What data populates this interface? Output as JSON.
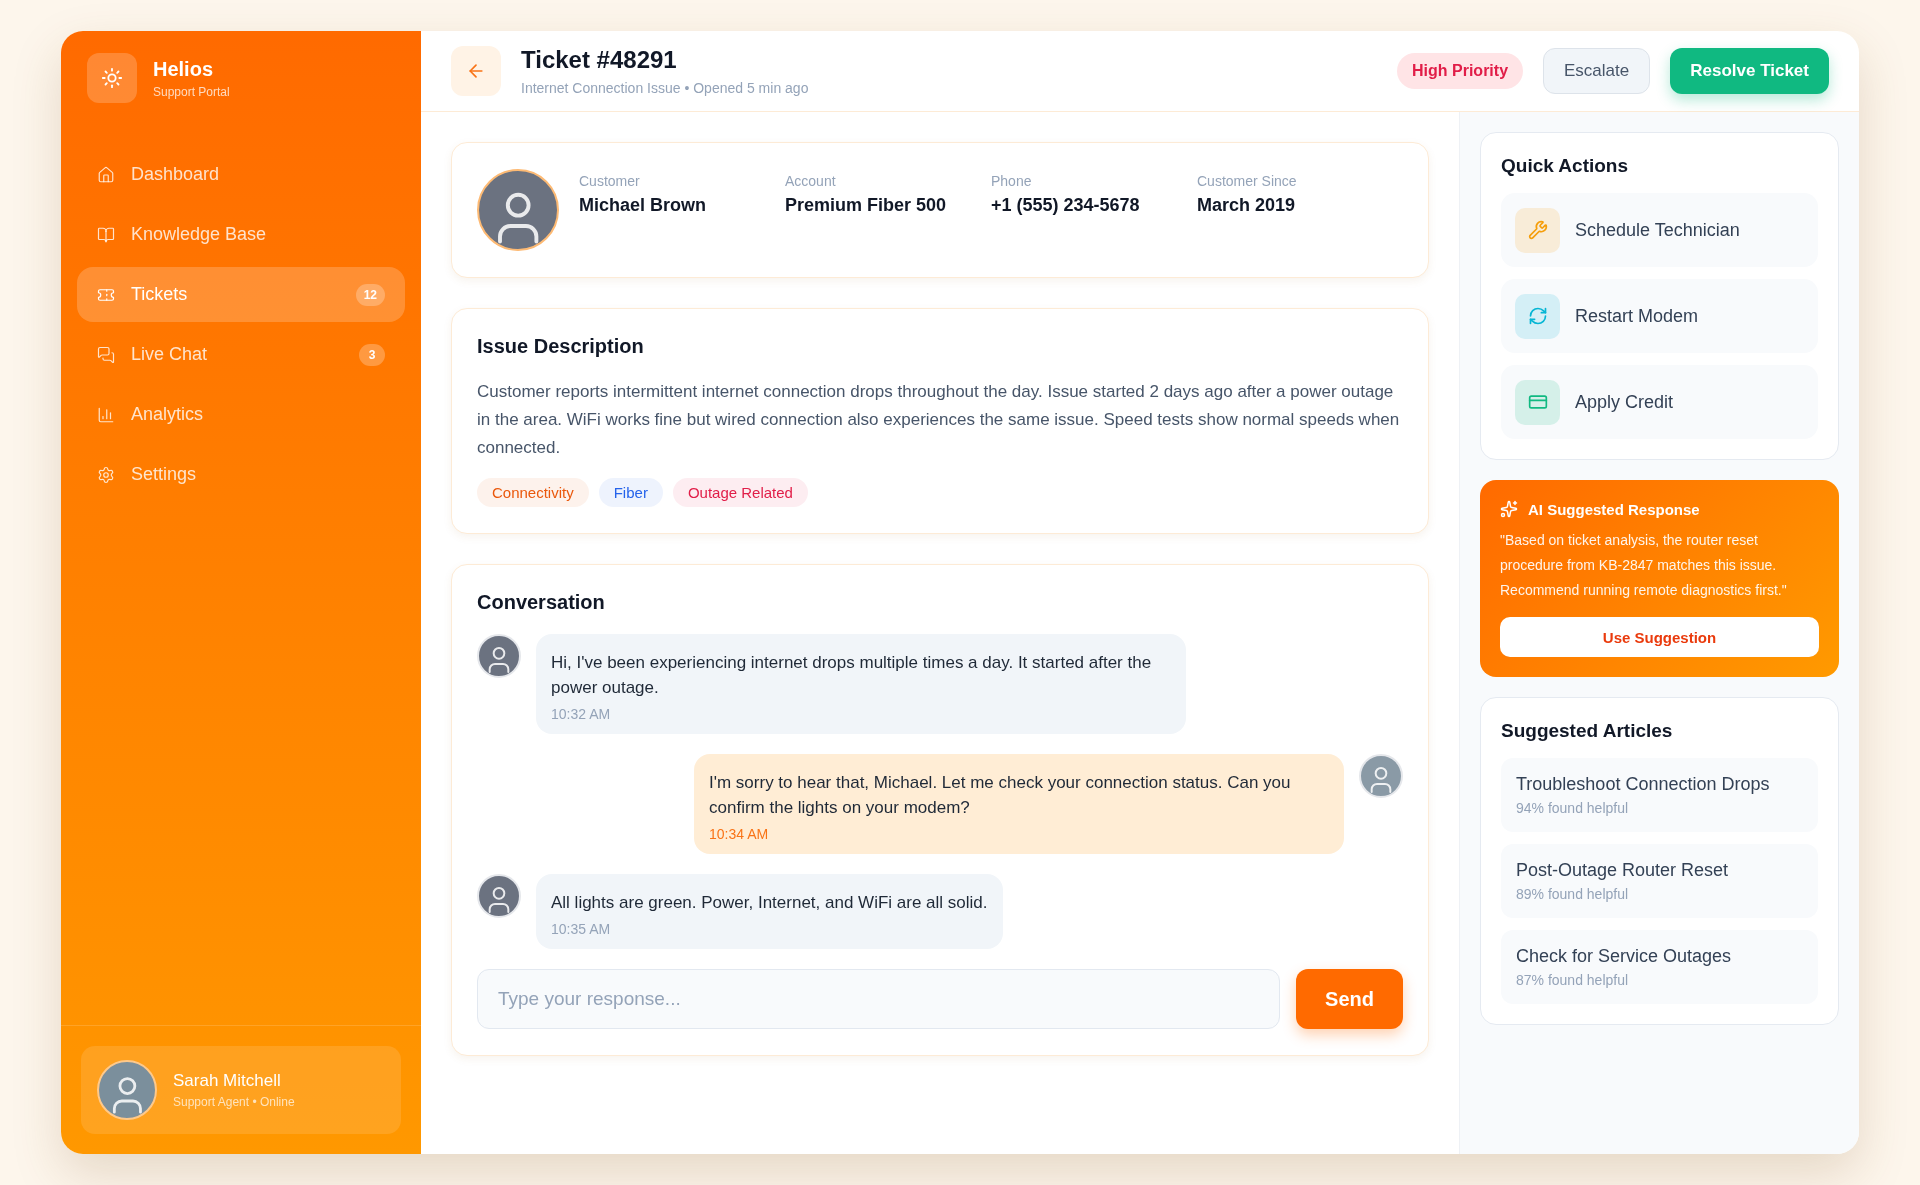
{
  "brand": {
    "name": "Helios",
    "subtitle": "Support Portal"
  },
  "nav": [
    {
      "label": "Dashboard",
      "kind": "home",
      "selected": false
    },
    {
      "label": "Knowledge Base",
      "kind": "book",
      "selected": false
    },
    {
      "label": "Tickets",
      "kind": "ticket",
      "selected": true,
      "badge": "12"
    },
    {
      "label": "Live Chat",
      "kind": "chat",
      "selected": false,
      "badge": "3"
    },
    {
      "label": "Analytics",
      "kind": "chart",
      "selected": false
    },
    {
      "label": "Settings",
      "kind": "gear",
      "selected": false
    }
  ],
  "user": {
    "name": "Sarah Mitchell",
    "role": "Support Agent • Online"
  },
  "header": {
    "title": "Ticket #48291",
    "subtitle": "Internet Connection Issue • Opened 5 min ago",
    "priority": "High Priority",
    "escalate": "Escalate",
    "resolve": "Resolve Ticket"
  },
  "customer": [
    {
      "label": "Customer",
      "value": "Michael Brown"
    },
    {
      "label": "Account",
      "value": "Premium Fiber 500"
    },
    {
      "label": "Phone",
      "value": "+1 (555) 234-5678"
    },
    {
      "label": "Customer Since",
      "value": "March 2019"
    }
  ],
  "issue": {
    "title": "Issue Description",
    "text": "Customer reports intermittent internet connection drops throughout the day. Issue started 2 days ago after a power outage in the area. WiFi works fine but wired connection also experiences the same issue. Speed tests show normal speeds when connected.",
    "tags": [
      {
        "label": "Connectivity",
        "color": "#ea580c"
      },
      {
        "label": "Fiber",
        "color": "#2563eb"
      },
      {
        "label": "Outage Related",
        "color": "#e11d48"
      }
    ]
  },
  "conversation": {
    "title": "Conversation",
    "messages": [
      {
        "kind": "customer",
        "text": "Hi, I've been experiencing internet drops multiple times a day. It started after the power outage.",
        "time": "10:32 AM"
      },
      {
        "kind": "agent",
        "text": "I'm sorry to hear that, Michael. Let me check your connection status. Can you confirm the lights on your modem?",
        "time": "10:34 AM"
      },
      {
        "kind": "customer",
        "text": "All lights are green. Power, Internet, and WiFi are all solid.",
        "time": "10:35 AM"
      }
    ],
    "placeholder": "Type your response...",
    "send": "Send"
  },
  "quick_actions": {
    "title": "Quick Actions",
    "items": [
      {
        "label": "Schedule Technician",
        "kind": "tools",
        "color": "#f59e0b"
      },
      {
        "label": "Restart Modem",
        "kind": "refresh",
        "color": "#06b6d4"
      },
      {
        "label": "Apply Credit",
        "kind": "card",
        "color": "#10b981"
      }
    ]
  },
  "ai": {
    "title": "AI Suggested Response",
    "text": "\"Based on ticket analysis, the router reset procedure from KB-2847 matches this issue. Recommend running remote diagnostics first.\"",
    "button": "Use Suggestion"
  },
  "articles": {
    "title": "Suggested Articles",
    "items": [
      {
        "title": "Troubleshoot Connection Drops",
        "helpful": "94% found helpful"
      },
      {
        "title": "Post-Outage Router Reset",
        "helpful": "89% found helpful"
      },
      {
        "title": "Check for Service Outages",
        "helpful": "87% found helpful"
      }
    ]
  }
}
